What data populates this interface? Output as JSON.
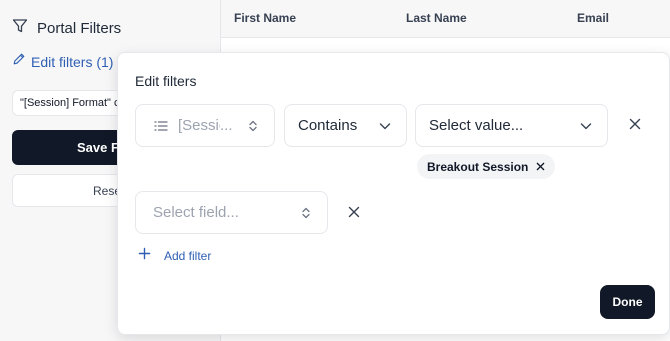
{
  "sidebar": {
    "title": "Portal Filters",
    "edit_link": "Edit filters (1)",
    "active_filter": "\"[Session] Format\" contains \"Breakout Session\"",
    "save_label": "Save Filters",
    "reset_label": "Reset Filters"
  },
  "table": {
    "columns": [
      "First Name",
      "Last Name",
      "Email"
    ]
  },
  "popover": {
    "title": "Edit filters",
    "rows": [
      {
        "field": "[Session] Format",
        "operator": "Contains",
        "value_placeholder": "Select value...",
        "chips": [
          "Breakout Session"
        ]
      },
      {
        "field_placeholder": "Select field..."
      }
    ],
    "add_filter_label": "Add filter",
    "done_label": "Done"
  },
  "colors": {
    "accent_link": "#2f5fb3",
    "primary_button": "#111827"
  }
}
